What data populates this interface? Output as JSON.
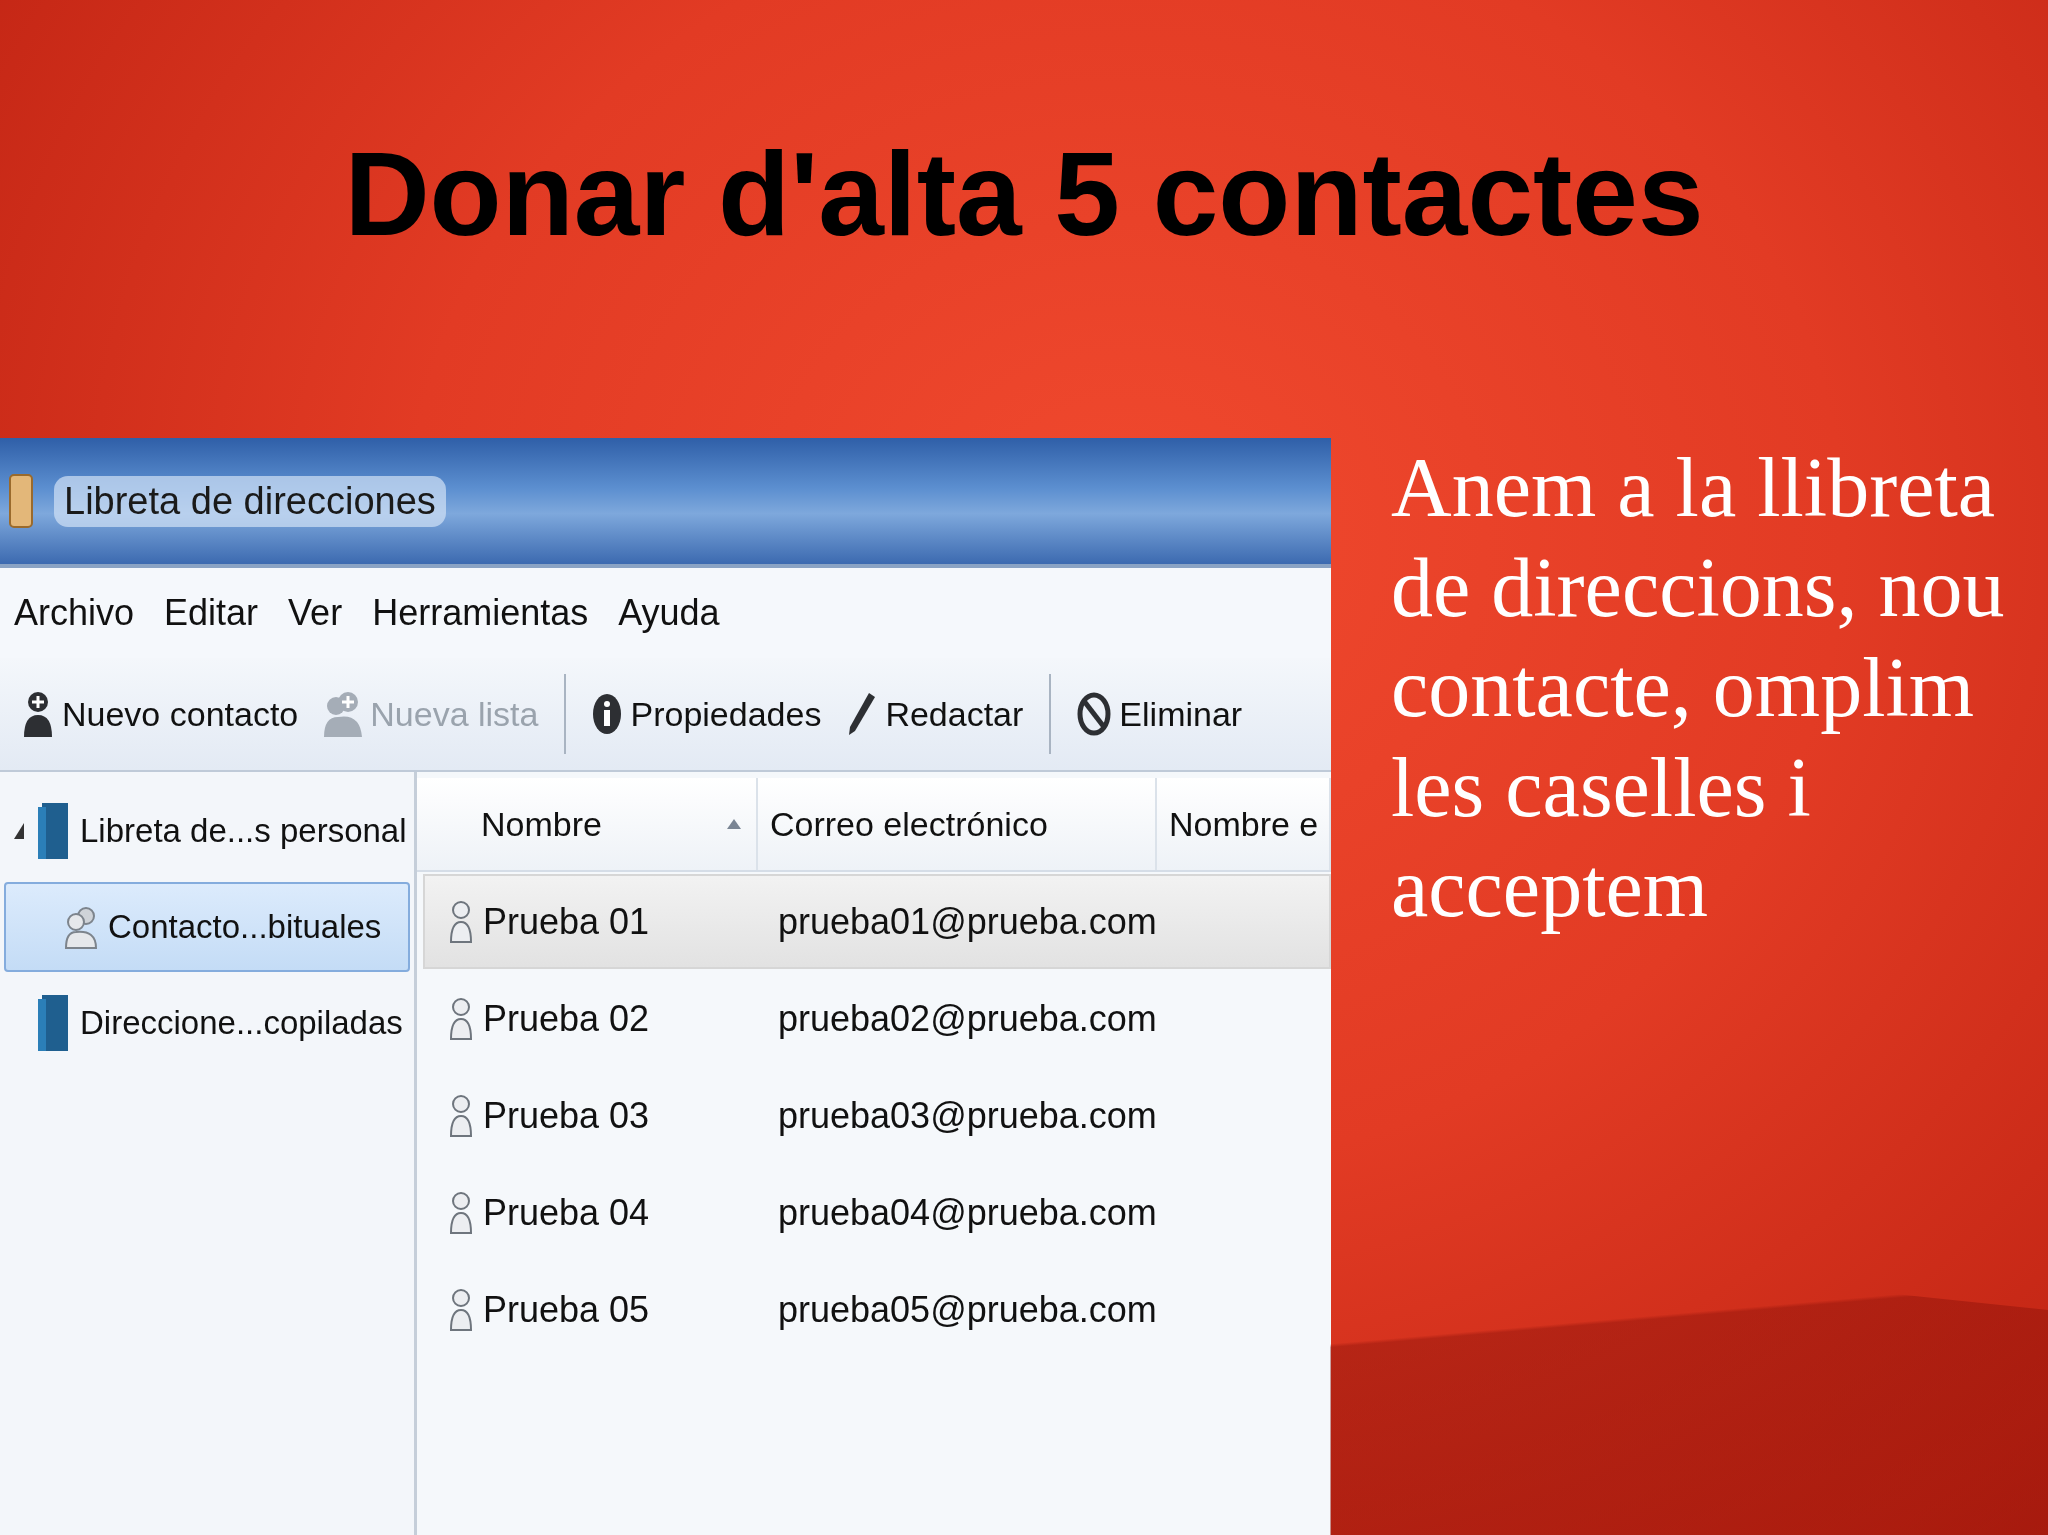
{
  "slide": {
    "title": "Donar d'alta 5 contactes",
    "body": "Anem a la llibreta de direccions, nou contacte, omplim les caselles i acceptem"
  },
  "window": {
    "title": "Libreta de direcciones"
  },
  "menu": [
    {
      "label": "Archivo"
    },
    {
      "label": "Editar"
    },
    {
      "label": "Ver"
    },
    {
      "label": "Herramientas"
    },
    {
      "label": "Ayuda"
    }
  ],
  "toolbar": [
    {
      "kind": "button",
      "label": "Nuevo contacto",
      "disabled": false
    },
    {
      "kind": "button",
      "label": "Nueva lista",
      "disabled": true
    },
    {
      "kind": "separator"
    },
    {
      "kind": "button",
      "label": "Propiedades",
      "disabled": false
    },
    {
      "kind": "button",
      "label": "Redactar",
      "disabled": false
    },
    {
      "kind": "separator"
    },
    {
      "kind": "button",
      "label": "Eliminar",
      "disabled": false
    }
  ],
  "tree": [
    {
      "kind": "book",
      "label": "Libreta de...s personal",
      "expanded": true,
      "selected": false,
      "children": [
        {
          "kind": "list",
          "label": "Contacto...bituales",
          "selected": true
        }
      ]
    },
    {
      "kind": "book",
      "label": "Direccione...copiladas",
      "selected": false
    }
  ],
  "table": {
    "columns": [
      {
        "label": "Nombre",
        "sorted": true
      },
      {
        "label": "Correo electrónico",
        "sorted": false
      },
      {
        "label": "Nombre e",
        "sorted": false
      }
    ],
    "rows": [
      {
        "selected": true,
        "cells": [
          "Prueba 01",
          "prueba01@prueba.com"
        ]
      },
      {
        "selected": false,
        "cells": [
          "Prueba 02",
          "prueba02@prueba.com"
        ]
      },
      {
        "selected": false,
        "cells": [
          "Prueba 03",
          "prueba03@prueba.com"
        ]
      },
      {
        "selected": false,
        "cells": [
          "Prueba 04",
          "prueba04@prueba.com"
        ]
      },
      {
        "selected": false,
        "cells": [
          "Prueba 05",
          "prueba05@prueba.com"
        ]
      }
    ]
  }
}
